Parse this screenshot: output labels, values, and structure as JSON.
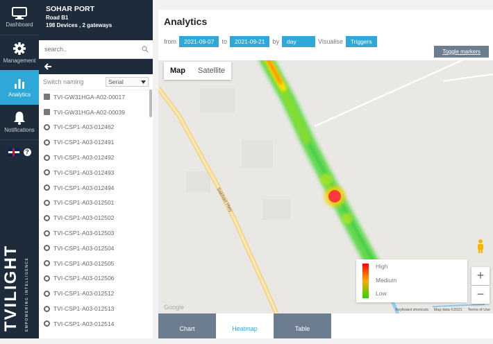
{
  "rail": {
    "items": [
      {
        "label": "Dashboard",
        "icon": "monitor-icon"
      },
      {
        "label": "Management",
        "icon": "gear-icon"
      },
      {
        "label": "Analytics",
        "icon": "bar-chart-icon"
      },
      {
        "label": "Notifications",
        "icon": "bell-icon"
      }
    ],
    "help": "?",
    "brand": "TVILIGHT",
    "tagline": "EMPOWERING INTELLIGENCE"
  },
  "site": {
    "name": "SOHAR PORT",
    "road": "Road B1",
    "summary": "198 Devices , 2 gateways"
  },
  "search": {
    "placeholder": "search..",
    "icon": "search-icon"
  },
  "back": {
    "icon": "arrow-left-icon",
    "glyph": "🡐"
  },
  "switch_naming": {
    "label": "Switch naming",
    "selected": "Serial"
  },
  "devices": [
    {
      "type": "gateway",
      "name": "TVI-GW31HGA-A02-00017"
    },
    {
      "type": "gateway",
      "name": "TVI-GW31HGA-A02-00039"
    },
    {
      "type": "lamp",
      "name": "TVI-CSP1-A03-012462"
    },
    {
      "type": "lamp",
      "name": "TVI-CSP1-A03-012491"
    },
    {
      "type": "lamp",
      "name": "TVI-CSP1-A03-012492"
    },
    {
      "type": "lamp",
      "name": "TVI-CSP1-A03-012493"
    },
    {
      "type": "lamp",
      "name": "TVI-CSP1-A03-012494"
    },
    {
      "type": "lamp",
      "name": "TVI-CSP1-A03-012501"
    },
    {
      "type": "lamp",
      "name": "TVI-CSP1-A03-012502"
    },
    {
      "type": "lamp",
      "name": "TVI-CSP1-A03-012503"
    },
    {
      "type": "lamp",
      "name": "TVI-CSP1-A03-012504"
    },
    {
      "type": "lamp",
      "name": "TVI-CSP1-A03-012505"
    },
    {
      "type": "lamp",
      "name": "TVI-CSP1-A03-012506"
    },
    {
      "type": "lamp",
      "name": "TVI-CSP1-A03-012512"
    },
    {
      "type": "lamp",
      "name": "TVI-CSP1-A03-012513"
    },
    {
      "type": "lamp",
      "name": "TVI-CSP1-A03-012514"
    }
  ],
  "analytics": {
    "title": "Analytics",
    "from_label": "from",
    "from": "2021-09-07",
    "to_label": "to",
    "to": "2021-09-21",
    "by_label": "by",
    "by": "day",
    "visualise_label": "Visualise",
    "visualise": "Triggers",
    "toggle_markers": "Toggle markers"
  },
  "map": {
    "types": [
      "Map",
      "Satellite"
    ],
    "road_name": "Sakhari Hwy",
    "legend": [
      "High",
      "Medium",
      "Low"
    ],
    "zoom_in": "+",
    "zoom_out": "−",
    "credits": [
      "Keyboard shortcuts",
      "Map data ©2021",
      "Terms of Use"
    ],
    "logo": "Google"
  },
  "tabs": [
    "Chart",
    "Heatmap",
    "Table"
  ],
  "colors": {
    "accent": "#2fa8d8",
    "dark": "#1d2b3a",
    "tab_bg": "#6b7d8f"
  }
}
